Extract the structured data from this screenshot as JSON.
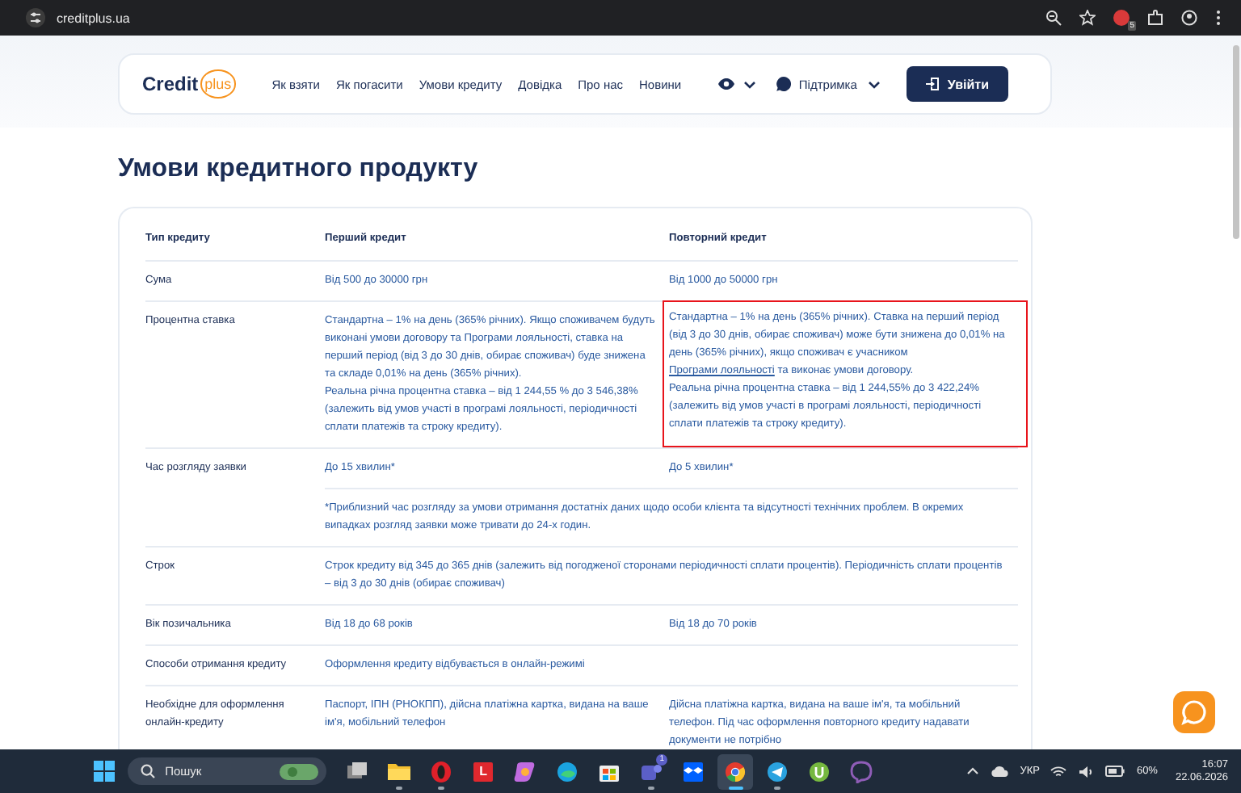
{
  "browser": {
    "url": "creditplus.ua",
    "extension_badge": "5"
  },
  "nav": {
    "logo": {
      "word": "Credit",
      "badge": "plus"
    },
    "links": [
      "Як взяти",
      "Як погасити",
      "Умови кредиту",
      "Довідка",
      "Про нас",
      "Новини"
    ],
    "support": "Підтримка",
    "login": "Увійти"
  },
  "page_title": "Умови кредитного продукту",
  "table": {
    "columns": [
      "Тип кредиту",
      "Перший кредит",
      "Повторний кредит"
    ],
    "rows": [
      {
        "cells": [
          {
            "text": "Сума"
          },
          {
            "text": "Від 500 до 30000 грн"
          },
          {
            "text": "Від 1000 до 50000 грн"
          }
        ]
      },
      {
        "cells": [
          {
            "text": "Процентна ставка"
          },
          {
            "text": "Стандартна – 1% на день (365% річних). Якщо споживачем будуть виконані умови договору та Програми лояльності, ставка на перший період (від 3 до 30 днів, обирає споживач) буде знижена та складе 0,01% на день (365% річних).\nРеальна річна процентна ставка – від 1 244,55 % до 3 546,38% (залежить від умов участі в програмі лояльності, періодичності сплати платежів та строку кредиту)."
          },
          {
            "text": "Стандартна – 1% на день (365% річних). Ставка на перший період (від 3 до 30 днів, обирає споживач) може бути знижена до 0,01% на день (365% річних), якщо споживач є учасником ",
            "link": "Програми лояльності",
            "text_after": " та виконає умови договору.\nРеальна річна процентна ставка – від 1 244,55% до 3 422,24% (залежить від умов участі в програмі лояльності, періодичності сплати платежів та строку кредиту).",
            "highlighted": true
          }
        ]
      },
      {
        "cells": [
          {
            "text": "Час розгляду заявки"
          },
          {
            "text": "До 15 хвилин*"
          },
          {
            "text": "До 5 хвилин*"
          }
        ]
      },
      {
        "cells": [
          {
            "text": ""
          },
          {
            "text": "*Приблизний час розгляду за умови отримання достатніх даних щодо особи клієнта та відсутності технічних проблем. В окремих випадках розгляд заявки може тривати до 24-х годин."
          }
        ]
      },
      {
        "cells": [
          {
            "text": "Строк"
          },
          {
            "text": "Строк кредиту від 345 до 365 днів (залежить від погодженої сторонами періодичності сплати процентів). Періодичність сплати процентів – від 3 до 30 днів (обирає споживач)"
          }
        ]
      },
      {
        "cells": [
          {
            "text": "Вік позичальника"
          },
          {
            "text": "Від 18 до 68 років"
          },
          {
            "text": "Від 18 до 70 років"
          }
        ]
      },
      {
        "cells": [
          {
            "text": "Способи отримання кредиту"
          },
          {
            "text": "Оформлення кредиту відбувається в онлайн-режимі"
          }
        ]
      },
      {
        "cells": [
          {
            "text": "Необхідне для оформлення онлайн-кредиту"
          },
          {
            "text": "Паспорт, ІПН (РНОКПП), дійсна платіжна картка, видана на ваше ім'я, мобільний телефон"
          },
          {
            "text": "Дійсна платіжна картка, видана на ваше ім'я, та мобільний телефон. Під час оформлення повторного кредиту надавати документи не потрібно"
          }
        ]
      }
    ]
  },
  "taskbar": {
    "search": "Пошук",
    "apps": [
      {
        "kind": "taskview"
      },
      {
        "kind": "folder",
        "running": true
      },
      {
        "kind": "opera",
        "running": true
      },
      {
        "kind": "letter",
        "label": "L"
      },
      {
        "kind": "copilot"
      },
      {
        "kind": "edge"
      },
      {
        "kind": "store"
      },
      {
        "kind": "teams",
        "badge": "1",
        "running": true
      },
      {
        "kind": "dropbox"
      },
      {
        "kind": "chrome",
        "running": true,
        "selected": true
      },
      {
        "kind": "telegram",
        "running": true
      },
      {
        "kind": "torrent"
      },
      {
        "kind": "viber"
      }
    ],
    "language": "УКР",
    "battery": "60%",
    "time": "16:07",
    "date": "22.06.2026"
  }
}
